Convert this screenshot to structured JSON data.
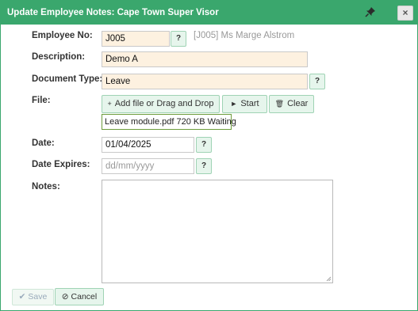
{
  "dialog": {
    "title": "Update Employee Notes: Cape Town Super Visor",
    "close_label": "×",
    "pin_icon": "pin-icon"
  },
  "form": {
    "employee_no": {
      "label": "Employee No:",
      "value": "J005",
      "lookup": "?",
      "resolved": "[J005] Ms Marge Alstrom"
    },
    "description": {
      "label": "Description:",
      "value": "Demo A"
    },
    "document_type": {
      "label": "Document Type:",
      "value": "Leave",
      "lookup": "?"
    },
    "file": {
      "label": "File:",
      "add_label": "Add file or Drag and Drop",
      "start_label": "Start",
      "clear_label": "Clear",
      "entry": "Leave module.pdf 720 KB Waiting"
    },
    "date": {
      "label": "Date:",
      "value": "01/04/2025",
      "lookup": "?"
    },
    "date_expires": {
      "label": "Date Expires:",
      "placeholder": "dd/mm/yyyy",
      "lookup": "?"
    },
    "notes": {
      "label": "Notes:",
      "value": ""
    }
  },
  "footer": {
    "save_label": "Save",
    "cancel_label": "Cancel"
  },
  "colors": {
    "accent": "#3aa76d",
    "field_bg": "#fdf1e0",
    "button_bg": "#e6f5ec"
  }
}
